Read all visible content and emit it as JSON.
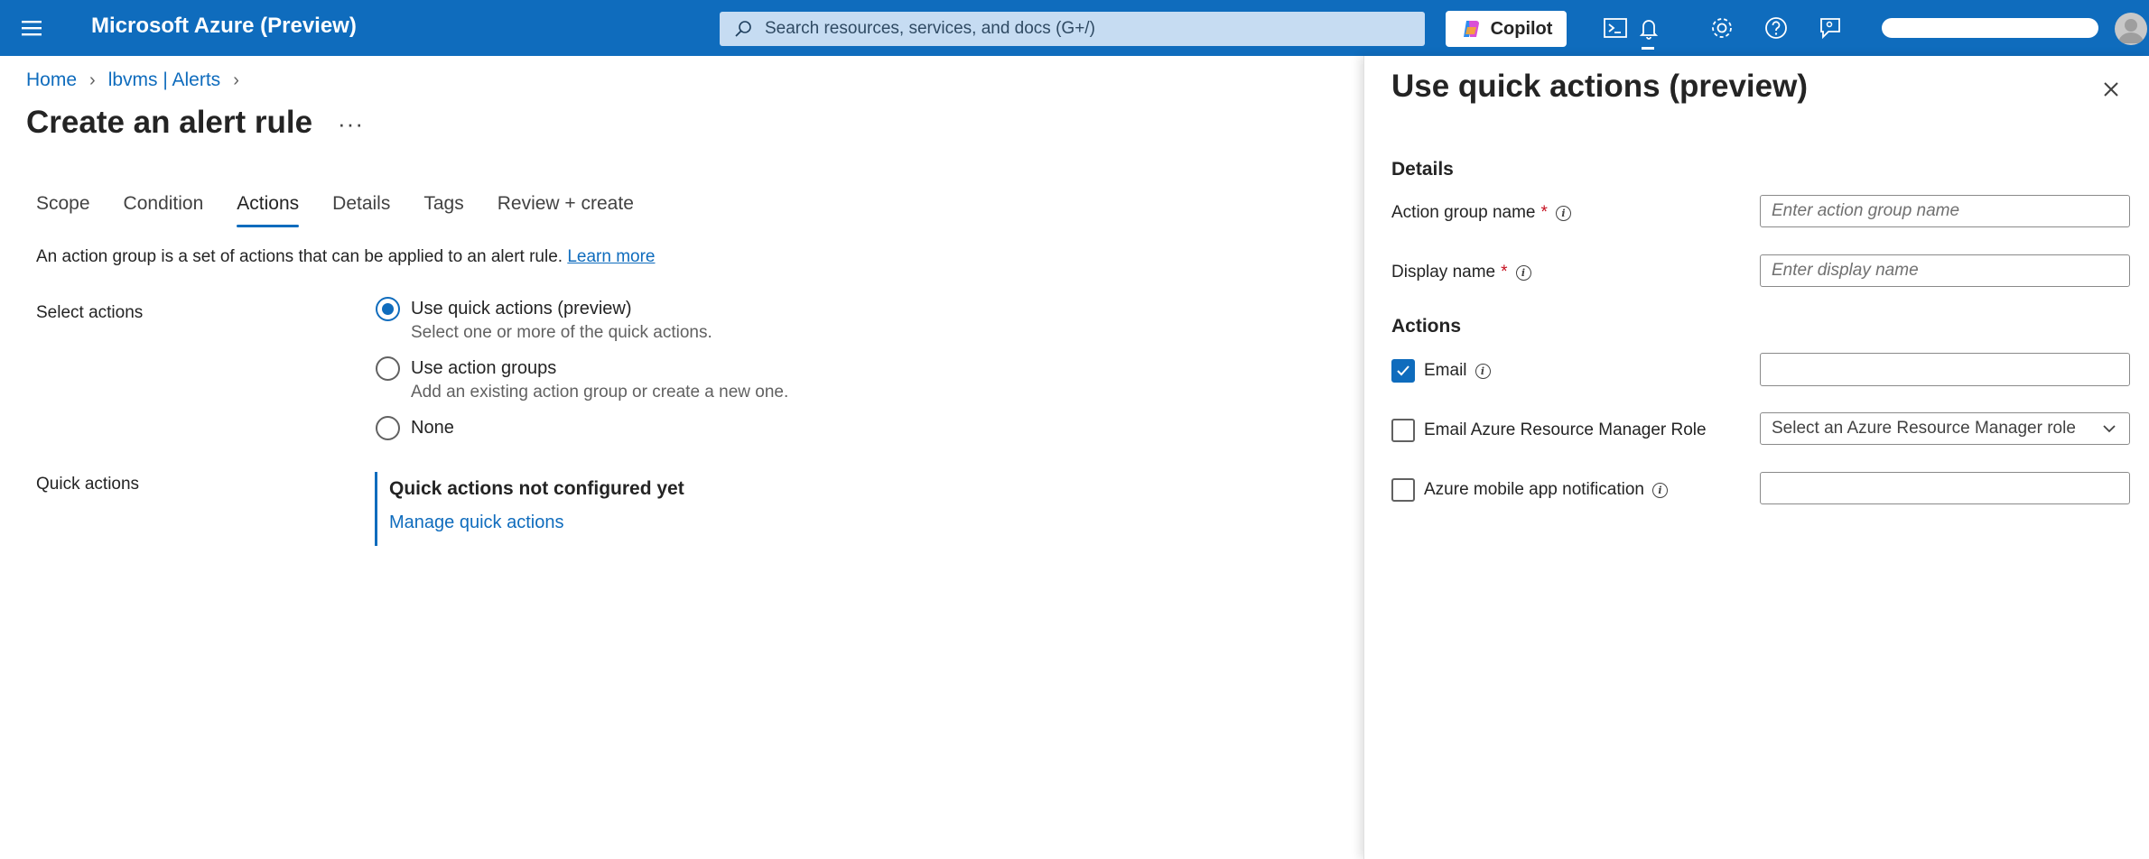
{
  "topbar": {
    "brand": "Microsoft Azure (Preview)",
    "search_placeholder": "Search resources, services, and docs (G+/)",
    "copilot_label": "Copilot",
    "colors": {
      "bar": "#0f6cbd",
      "search_bg": "#c6dcf2"
    },
    "icons": [
      "menu-icon",
      "search-icon",
      "copilot-icon",
      "cloud-shell-icon",
      "bell-icon",
      "gear-icon",
      "help-icon",
      "feedback-icon",
      "avatar"
    ]
  },
  "breadcrumb": [
    "Home",
    "lbvms | Alerts"
  ],
  "page": {
    "title": "Create an alert rule",
    "more": "···"
  },
  "tabs": [
    {
      "label": "Scope",
      "active": false
    },
    {
      "label": "Condition",
      "active": false
    },
    {
      "label": "Actions",
      "active": true
    },
    {
      "label": "Details",
      "active": false
    },
    {
      "label": "Tags",
      "active": false
    },
    {
      "label": "Review + create",
      "active": false
    }
  ],
  "actions": {
    "intro": "An action group is a set of actions that can be applied to an alert rule.",
    "learn_more": "Learn more",
    "select_label": "Select actions",
    "options": [
      {
        "label": "Use quick actions (preview)",
        "sub": "Select one or more of the quick actions.",
        "checked": true
      },
      {
        "label": "Use action groups",
        "sub": "Add an existing action group or create a new one.",
        "checked": false
      },
      {
        "label": "None",
        "sub": "",
        "checked": false
      }
    ],
    "quick_label": "Quick actions",
    "quick_title": "Quick actions not configured yet",
    "quick_link": "Manage quick actions"
  },
  "panel": {
    "title": "Use quick actions (preview)",
    "details_heading": "Details",
    "action_group_name_label": "Action group name",
    "action_group_name_placeholder": "Enter action group name",
    "display_name_label": "Display name",
    "display_name_placeholder": "Enter display name",
    "required_mark": "*",
    "actions_heading": "Actions",
    "email_label": "Email",
    "email_checked": true,
    "arm_role_label": "Email Azure Resource Manager Role",
    "arm_role_checked": false,
    "arm_role_select": "Select an Azure Resource Manager role",
    "mobile_label": "Azure mobile app notification",
    "mobile_checked": false
  }
}
